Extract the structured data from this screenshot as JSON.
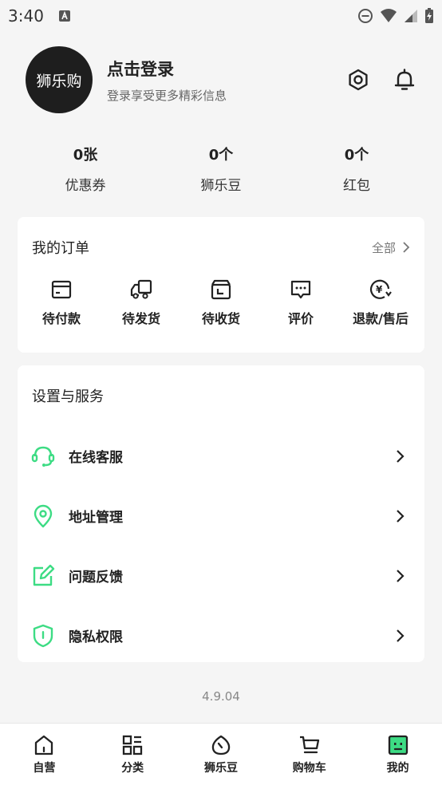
{
  "status_bar": {
    "time": "3:40"
  },
  "profile": {
    "avatar_text": "狮乐购",
    "login_title": "点击登录",
    "login_subtitle": "登录享受更多精彩信息"
  },
  "stats": [
    {
      "value": "0张",
      "label": "优惠券"
    },
    {
      "value": "0个",
      "label": "狮乐豆"
    },
    {
      "value": "0个",
      "label": "红包"
    }
  ],
  "orders": {
    "title": "我的订单",
    "all_label": "全部",
    "items": [
      {
        "label": "待付款",
        "icon": "wallet-icon"
      },
      {
        "label": "待发货",
        "icon": "truck-icon"
      },
      {
        "label": "待收货",
        "icon": "box-icon"
      },
      {
        "label": "评价",
        "icon": "comment-icon"
      },
      {
        "label": "退款/售后",
        "icon": "refund-icon"
      }
    ]
  },
  "services": {
    "title": "设置与服务",
    "items": [
      {
        "label": "在线客服",
        "icon": "headset-icon"
      },
      {
        "label": "地址管理",
        "icon": "location-icon"
      },
      {
        "label": "问题反馈",
        "icon": "edit-icon"
      },
      {
        "label": "隐私权限",
        "icon": "shield-icon"
      }
    ]
  },
  "version": "4.9.04",
  "tabs": [
    {
      "label": "自营",
      "icon": "home-icon"
    },
    {
      "label": "分类",
      "icon": "grid-icon"
    },
    {
      "label": "狮乐豆",
      "icon": "bean-icon"
    },
    {
      "label": "购物车",
      "icon": "cart-icon"
    },
    {
      "label": "我的",
      "icon": "profile-icon"
    }
  ],
  "colors": {
    "accent_green": "#3ddc84",
    "background": "#f5f5f5",
    "card": "#ffffff",
    "text_primary": "#222222",
    "text_secondary": "#777777"
  }
}
